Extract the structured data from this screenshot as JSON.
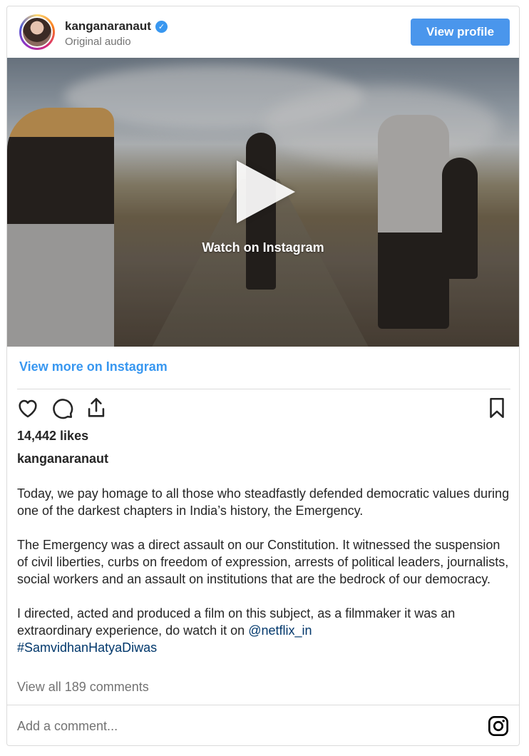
{
  "header": {
    "username": "kanganaranaut",
    "subtitle": "Original audio",
    "verified_mark": "✓",
    "view_profile_label": "View profile"
  },
  "media": {
    "watch_label": "Watch on Instagram"
  },
  "view_more_label": "View more on Instagram",
  "actions": {
    "icons": [
      "heart-icon",
      "comment-icon",
      "share-icon",
      "bookmark-icon"
    ]
  },
  "likes": "14,442 likes",
  "caption": {
    "username": "kanganaranaut",
    "paragraph1": "Today, we pay homage to all those who steadfastly defended democratic values during one of the darkest chapters in India’s history, the Emergency.",
    "paragraph2": "The Emergency was a direct assault on our Constitution. It witnessed the suspension of civil liberties, curbs on freedom of expression, arrests of political leaders, journalists, social workers and an assault on institutions that are the bedrock of our democracy.",
    "paragraph3_text": "I directed, acted and produced a film on this subject, as a filmmaker it was an extraordinary experience, do watch it on ",
    "mention": "@netflix_in",
    "hashtag": "#SamvidhanHatyaDiwas"
  },
  "comments_link": "View all 189 comments",
  "comment_input": {
    "placeholder": "Add a comment..."
  },
  "colors": {
    "accent": "#3897f0",
    "button": "#4a96ec",
    "link": "#00376b",
    "muted": "#737373"
  }
}
